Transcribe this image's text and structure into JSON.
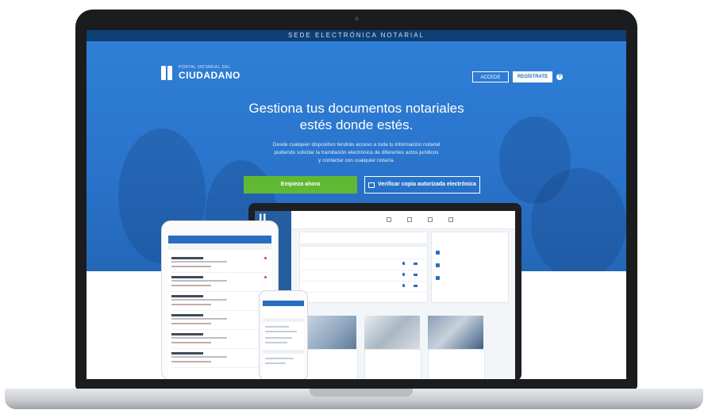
{
  "site": {
    "topbar_title": "SEDE ELECTRÓNICA NOTARIAL",
    "logo_small": "PORTAL NOTARIAL DEL",
    "logo_big": "CIUDADANO"
  },
  "header": {
    "access_label": "ACCEDE",
    "register_label": "REGÍSTRATE",
    "help_label": "?"
  },
  "hero": {
    "headline_line1": "Gestiona tus documentos notariales",
    "headline_line2": "estés donde estés.",
    "description_line1": "Desde cualquier dispositivo tendrás acceso a toda tu información notarial",
    "description_line2": "pudiendo solicitar la tramitación electrónica de diferentes actos jurídicos",
    "description_line3": "y contactar con cualquier notaría.",
    "start_button": "Empieza ahora",
    "verify_button": "Verificar copia autorizada electrónica"
  },
  "colors": {
    "hero_blue": "#2a74cc",
    "topbar_navy": "#0e3e73",
    "start_green": "#61b833"
  },
  "icons": [
    "logo-icon",
    "help-icon",
    "grid-icon",
    "camera-dot"
  ]
}
